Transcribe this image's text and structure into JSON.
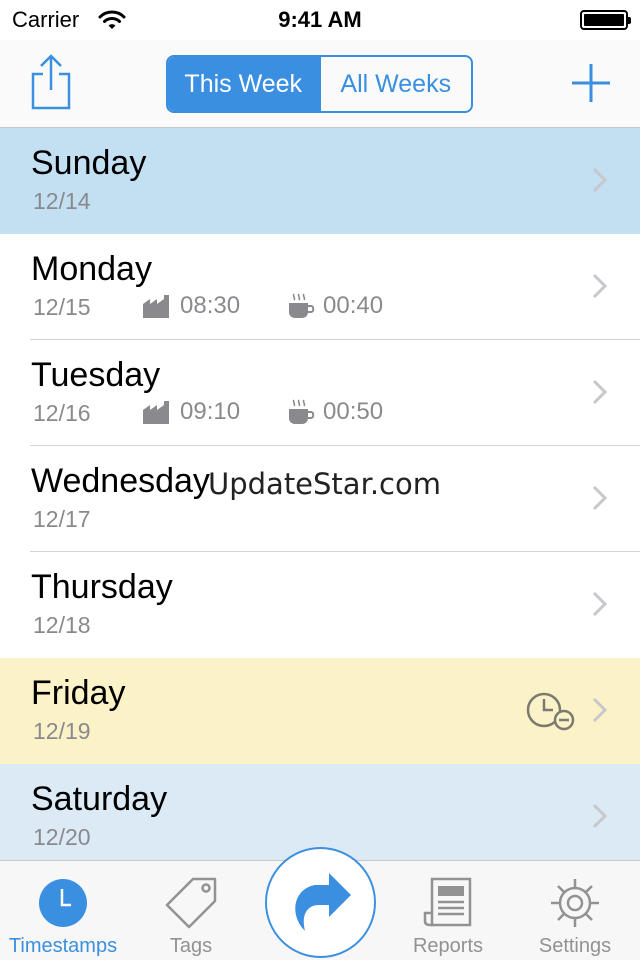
{
  "status_bar": {
    "carrier": "Carrier",
    "time": "9:41 AM"
  },
  "nav": {
    "segments": [
      {
        "label": "This Week",
        "active": true
      },
      {
        "label": "All Weeks",
        "active": false
      }
    ],
    "share_icon": "share-icon",
    "add_icon": "plus-icon"
  },
  "days": [
    {
      "name": "Sunday",
      "date": "12/14"
    },
    {
      "name": "Monday",
      "date": "12/15",
      "work": "08:30",
      "break": "00:40"
    },
    {
      "name": "Tuesday",
      "date": "12/16",
      "work": "09:10",
      "break": "00:50"
    },
    {
      "name": "Wednesday",
      "date": "12/17"
    },
    {
      "name": "Thursday",
      "date": "12/18"
    },
    {
      "name": "Friday",
      "date": "12/19"
    },
    {
      "name": "Saturday",
      "date": "12/20"
    }
  ],
  "watermark": "UpdateStar.com",
  "tabs": [
    {
      "label": "Timestamps",
      "icon": "clock-icon",
      "active": true
    },
    {
      "label": "Tags",
      "icon": "tag-icon",
      "active": false
    },
    {
      "label": "Reports",
      "icon": "report-icon",
      "active": false
    },
    {
      "label": "Settings",
      "icon": "gear-icon",
      "active": false
    }
  ],
  "colors": {
    "accent": "#3b8fe0",
    "selected_row": "#c3dff2",
    "today_row": "#fcf2c8",
    "weekend_row": "#dbeaf5",
    "secondary_text": "#8a8a8e"
  }
}
